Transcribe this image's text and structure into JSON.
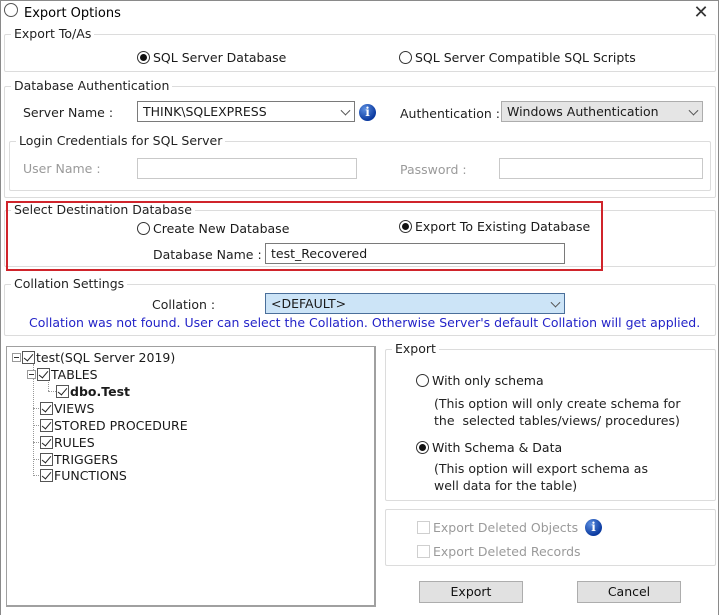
{
  "window": {
    "title": "Export Options",
    "close_glyph": "✕"
  },
  "export_to": {
    "legend": "Export To/As",
    "options": [
      {
        "label": "SQL Server Database",
        "selected": true
      },
      {
        "label": "SQL Server Compatible SQL Scripts",
        "selected": false
      }
    ]
  },
  "db_auth": {
    "legend": "Database Authentication",
    "server_label": "Server Name :",
    "server_value": "THINK\\SQLEXPRESS",
    "info_glyph": "i",
    "auth_label": "Authentication :",
    "auth_value": "Windows Authentication",
    "login": {
      "legend": "Login Credentials for SQL Server",
      "username_label": "User Name :",
      "username_value": "",
      "password_label": "Password :",
      "password_value": ""
    }
  },
  "destination": {
    "legend": "Select Destination Database",
    "options": [
      {
        "label": "Create New Database",
        "selected": false
      },
      {
        "label": "Export To Existing Database",
        "selected": true
      }
    ],
    "dbname_label": "Database Name :",
    "dbname_value": "test_Recovered",
    "highlight_color": "#d0242b"
  },
  "collation": {
    "legend": "Collation Settings",
    "label": "Collation :",
    "value": "<DEFAULT>",
    "note": "Collation was not found. User can select the Collation. Otherwise Server's default Collation will get applied.",
    "note_color": "#2323c8"
  },
  "tree": {
    "root": "test(SQL Server 2019)",
    "tables": "TABLES",
    "table_items": [
      "dbo.Test"
    ],
    "others": [
      "VIEWS",
      "STORED PROCEDURE",
      "RULES",
      "TRIGGERS",
      "FUNCTIONS"
    ]
  },
  "export_mode": {
    "legend": "Export",
    "options": [
      {
        "label": "With only schema",
        "selected": false,
        "desc": "(This option will only create schema for\nthe  selected tables/views/ procedures)"
      },
      {
        "label": "With Schema & Data",
        "selected": true,
        "desc": "(This option will export schema as\nwell data for the table)"
      }
    ]
  },
  "deleted": {
    "objects_label": "Export Deleted Objects",
    "records_label": "Export Deleted Records",
    "objects_checked": false,
    "records_checked": false
  },
  "buttons": {
    "export": "Export",
    "cancel": "Cancel"
  }
}
